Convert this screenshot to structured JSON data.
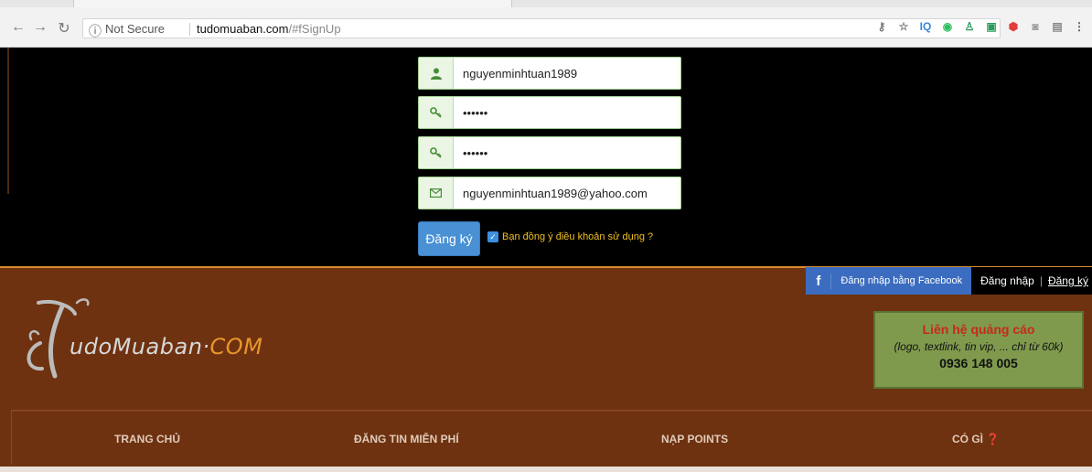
{
  "browser": {
    "security_label": "Not Secure",
    "url_host": "tudomuaban.com",
    "url_path": "/#fSignUp",
    "extensions": [
      {
        "name": "iq",
        "glyph": "IQ",
        "color": "#3a86d9"
      },
      {
        "name": "evernote",
        "glyph": "◉",
        "color": "#2dbe60"
      },
      {
        "name": "person",
        "glyph": "♙",
        "color": "#2a9d5c"
      },
      {
        "name": "screen",
        "glyph": "▣",
        "color": "#2a9d5c"
      },
      {
        "name": "shield",
        "glyph": "⬢",
        "color": "#e23b3b"
      },
      {
        "name": "camera",
        "glyph": "◙",
        "color": "#999999"
      },
      {
        "name": "save",
        "glyph": "▤",
        "color": "#888888"
      }
    ]
  },
  "signup": {
    "username": "nguyenminhtuan1989",
    "password": "••••••",
    "confirm_password": "••••••",
    "email": "nguyenminhtuan1989@yahoo.com",
    "register_label": "Đăng ký",
    "agree_label": "Bạn đồng ý điều khoản sử dụng ?"
  },
  "login": {
    "facebook_label": "Đăng nhập bằng Facebook",
    "login_label": "Đăng nhập",
    "separator": "|",
    "register_label": "Đăng ký"
  },
  "logo": {
    "text_main": "udoMuaban·",
    "text_suffix": "COM"
  },
  "ad": {
    "title": "Liên hệ quảng cáo",
    "subtitle": "(logo, textlink, tin vip, ... chỉ từ 60k)",
    "phone": "0936 148 005"
  },
  "menu": {
    "items": [
      "TRANG CHỦ",
      "ĐĂNG TIN MIỄN PHÍ",
      "NẠP POINTS",
      "CÓ GÌ ❓"
    ]
  },
  "colors": {
    "brown": "#6e3210",
    "accent": "#4a90d4",
    "gold": "#f0c020"
  }
}
